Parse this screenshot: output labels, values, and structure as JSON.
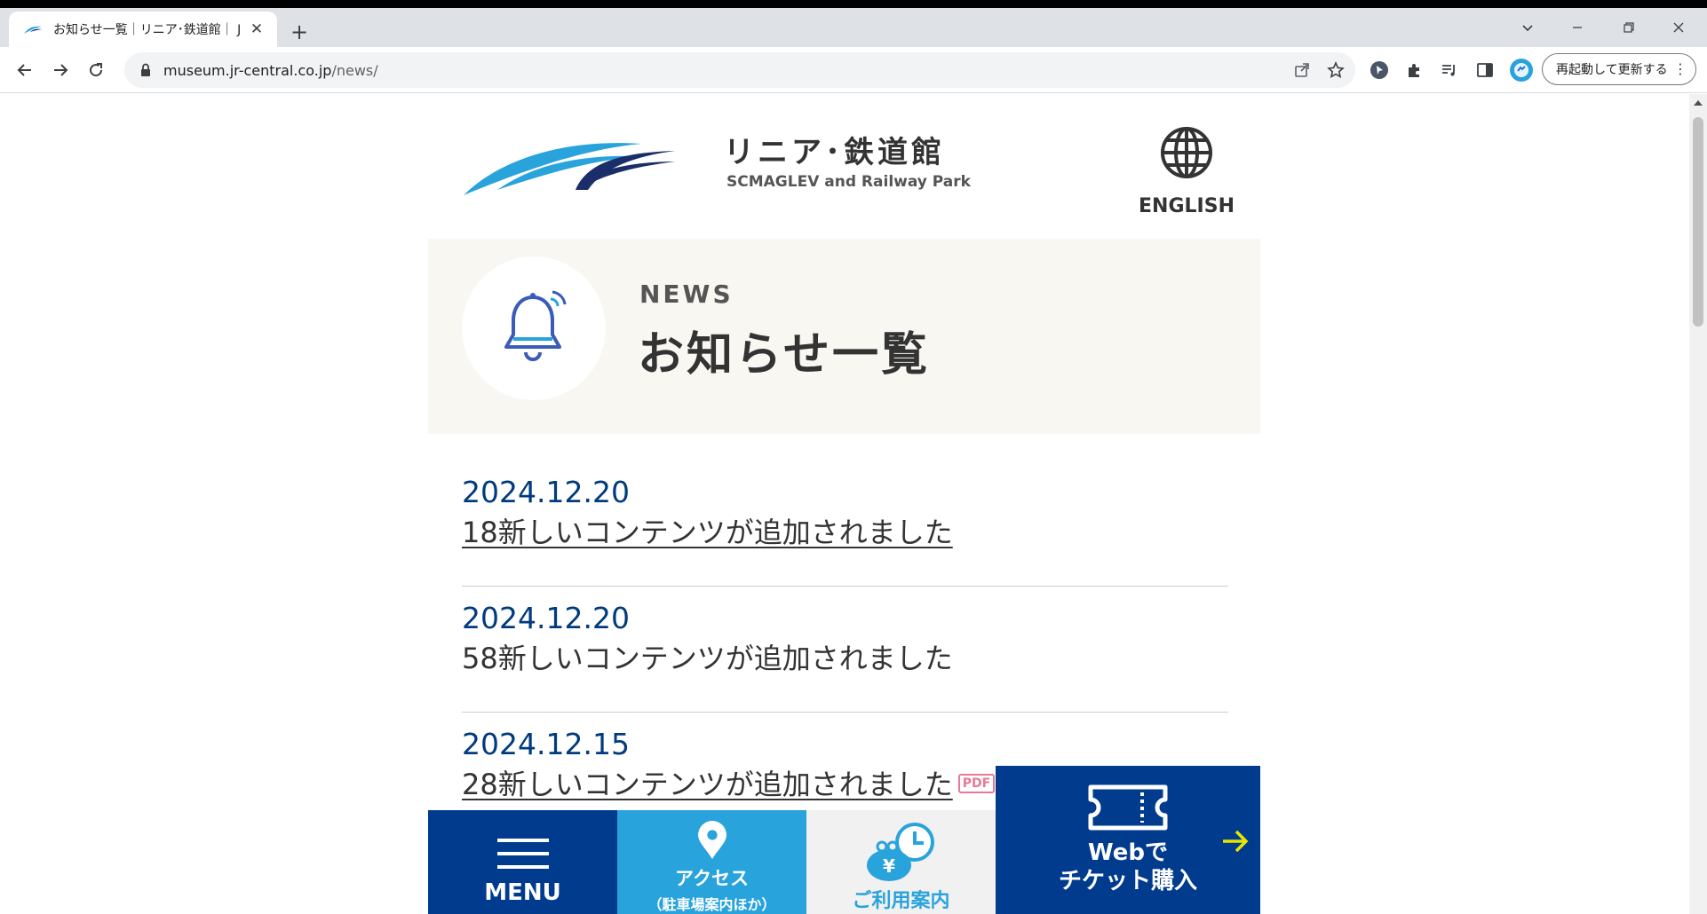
{
  "browser": {
    "tab_title": "お知らせ一覧｜リニア･鉄道館｜ J",
    "url_domain": "museum.jr-central.co.jp",
    "url_path": "/news/",
    "update_button": "再起動して更新する"
  },
  "site": {
    "brand_jp": "リニア･鉄道館",
    "brand_en": "SCMAGLEV and Railway Park",
    "language_link": "ENGLISH"
  },
  "hero": {
    "label_en": "NEWS",
    "title_jp": "お知らせ一覧"
  },
  "news": [
    {
      "date": "2024.12.20",
      "title": "18新しいコンテンツが追加されました",
      "linked": true,
      "pdf": ""
    },
    {
      "date": "2024.12.20",
      "title": "58新しいコンテンツが追加されました",
      "linked": false,
      "pdf": ""
    },
    {
      "date": "2024.12.15",
      "title": "28新しいコンテンツが追加されました",
      "linked": true,
      "pdf": "PDF"
    }
  ],
  "bottom_nav": {
    "menu": "MENU",
    "access": "アクセス",
    "access_sub": "（駐車場案内ほか）",
    "guide": "ご利用案内",
    "ticket_line1": "Webで",
    "ticket_line2": "チケット購入"
  },
  "colors": {
    "brand_navy": "#003b8e",
    "brand_sky": "#29a3dc",
    "date_blue": "#003b7e",
    "hero_bg": "#f9f7f1",
    "pdf_pink": "#e87a92"
  }
}
